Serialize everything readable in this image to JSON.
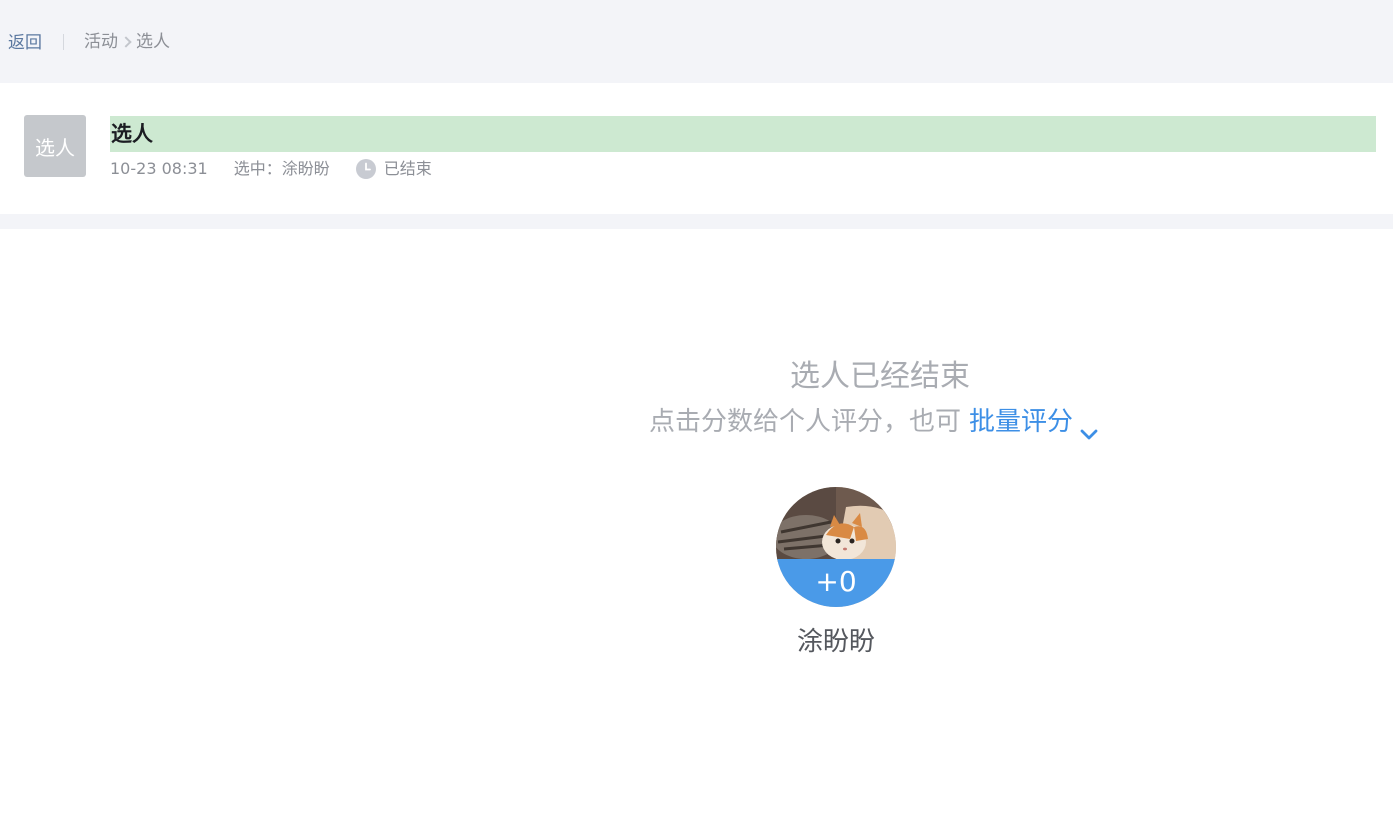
{
  "topbar": {
    "back_label": "返回",
    "breadcrumb": [
      "活动",
      "选人"
    ]
  },
  "activity": {
    "thumb_label": "选人",
    "title": "选人",
    "time": "10-23 08:31",
    "selected_label": "选中：",
    "selected_name": "涂盼盼",
    "status": "已结束",
    "clock_icon": "clock-icon"
  },
  "result": {
    "title": "选人已经结束",
    "hint": "点击分数给个人评分，也可",
    "batch_label": "批量评分",
    "chevron_icon": "chevron-down-icon"
  },
  "person": {
    "score": "+0",
    "name": "涂盼盼",
    "avatar_icon": "cat-photo-avatar"
  },
  "colors": {
    "accent": "#3d8fe6",
    "score_band": "#4a9ae8",
    "title_highlight": "#cde9d1",
    "topbar_bg": "#f3f4f8"
  }
}
